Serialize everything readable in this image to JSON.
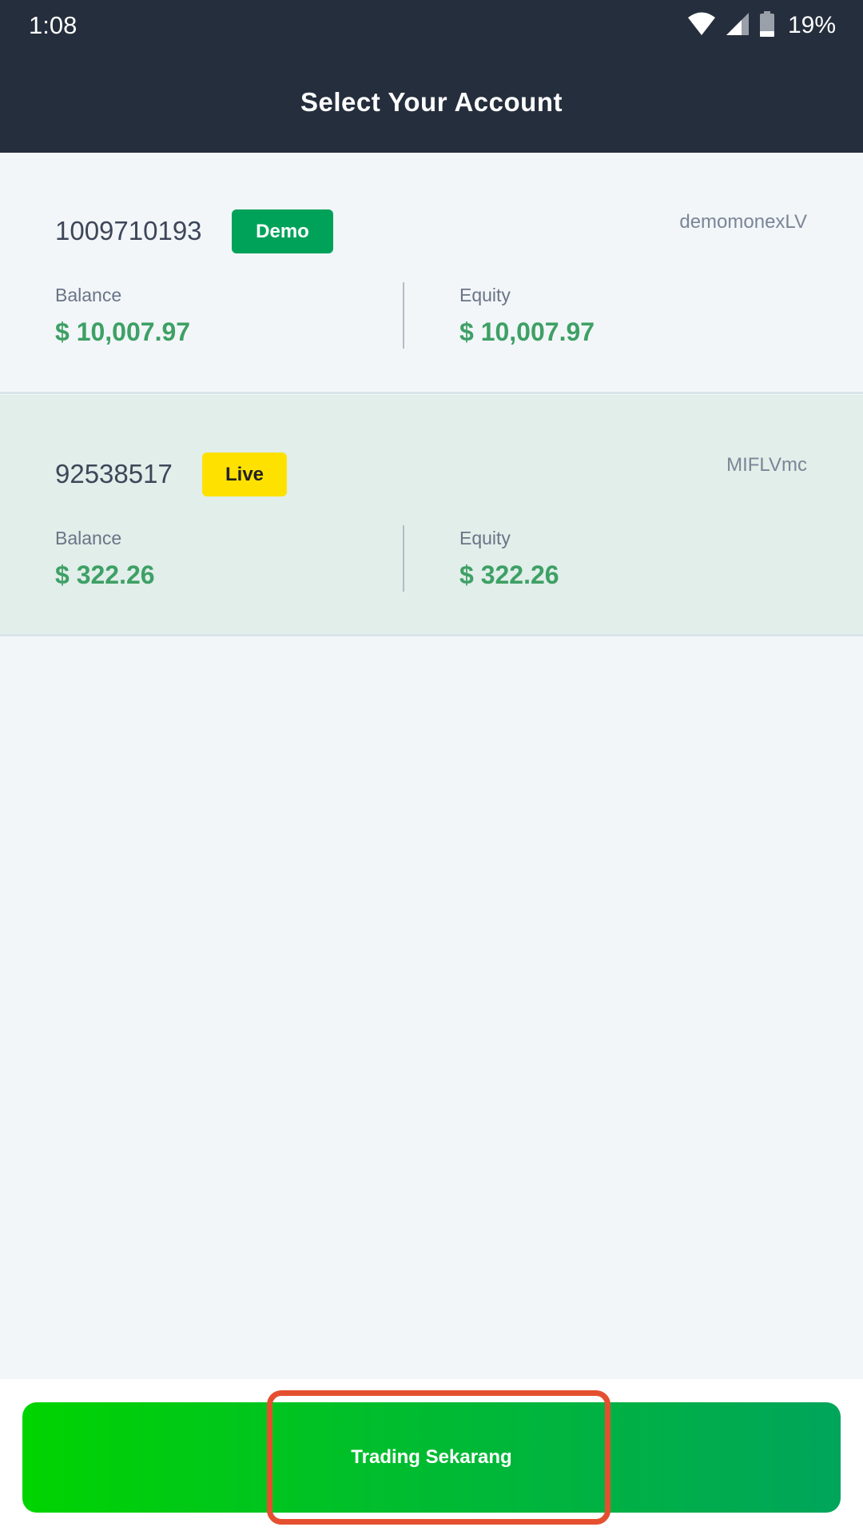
{
  "status_bar": {
    "time": "1:08",
    "battery_percent": "19%",
    "icons": [
      "wifi-icon",
      "cellular-signal-icon",
      "battery-icon"
    ]
  },
  "header": {
    "title": "Select Your Account"
  },
  "accounts": [
    {
      "number": "1009710193",
      "badge": "Demo",
      "server": "demomonexLV",
      "balance_label": "Balance",
      "balance_value": "$ 10,007.97",
      "equity_label": "Equity",
      "equity_value": "$ 10,007.97"
    },
    {
      "number": "92538517",
      "badge": "Live",
      "server": "MIFLVmc",
      "balance_label": "Balance",
      "balance_value": "$ 322.26",
      "equity_label": "Equity",
      "equity_value": "$ 322.26"
    }
  ],
  "footer": {
    "trade_button_label": "Trading Sekarang"
  },
  "colors": {
    "header_bg": "#252e3c",
    "value_green": "#3ea065",
    "demo_badge": "#00a25a",
    "live_badge": "#ffe100",
    "live_row_bg": "#e1eeea",
    "highlight": "#e4502f"
  }
}
